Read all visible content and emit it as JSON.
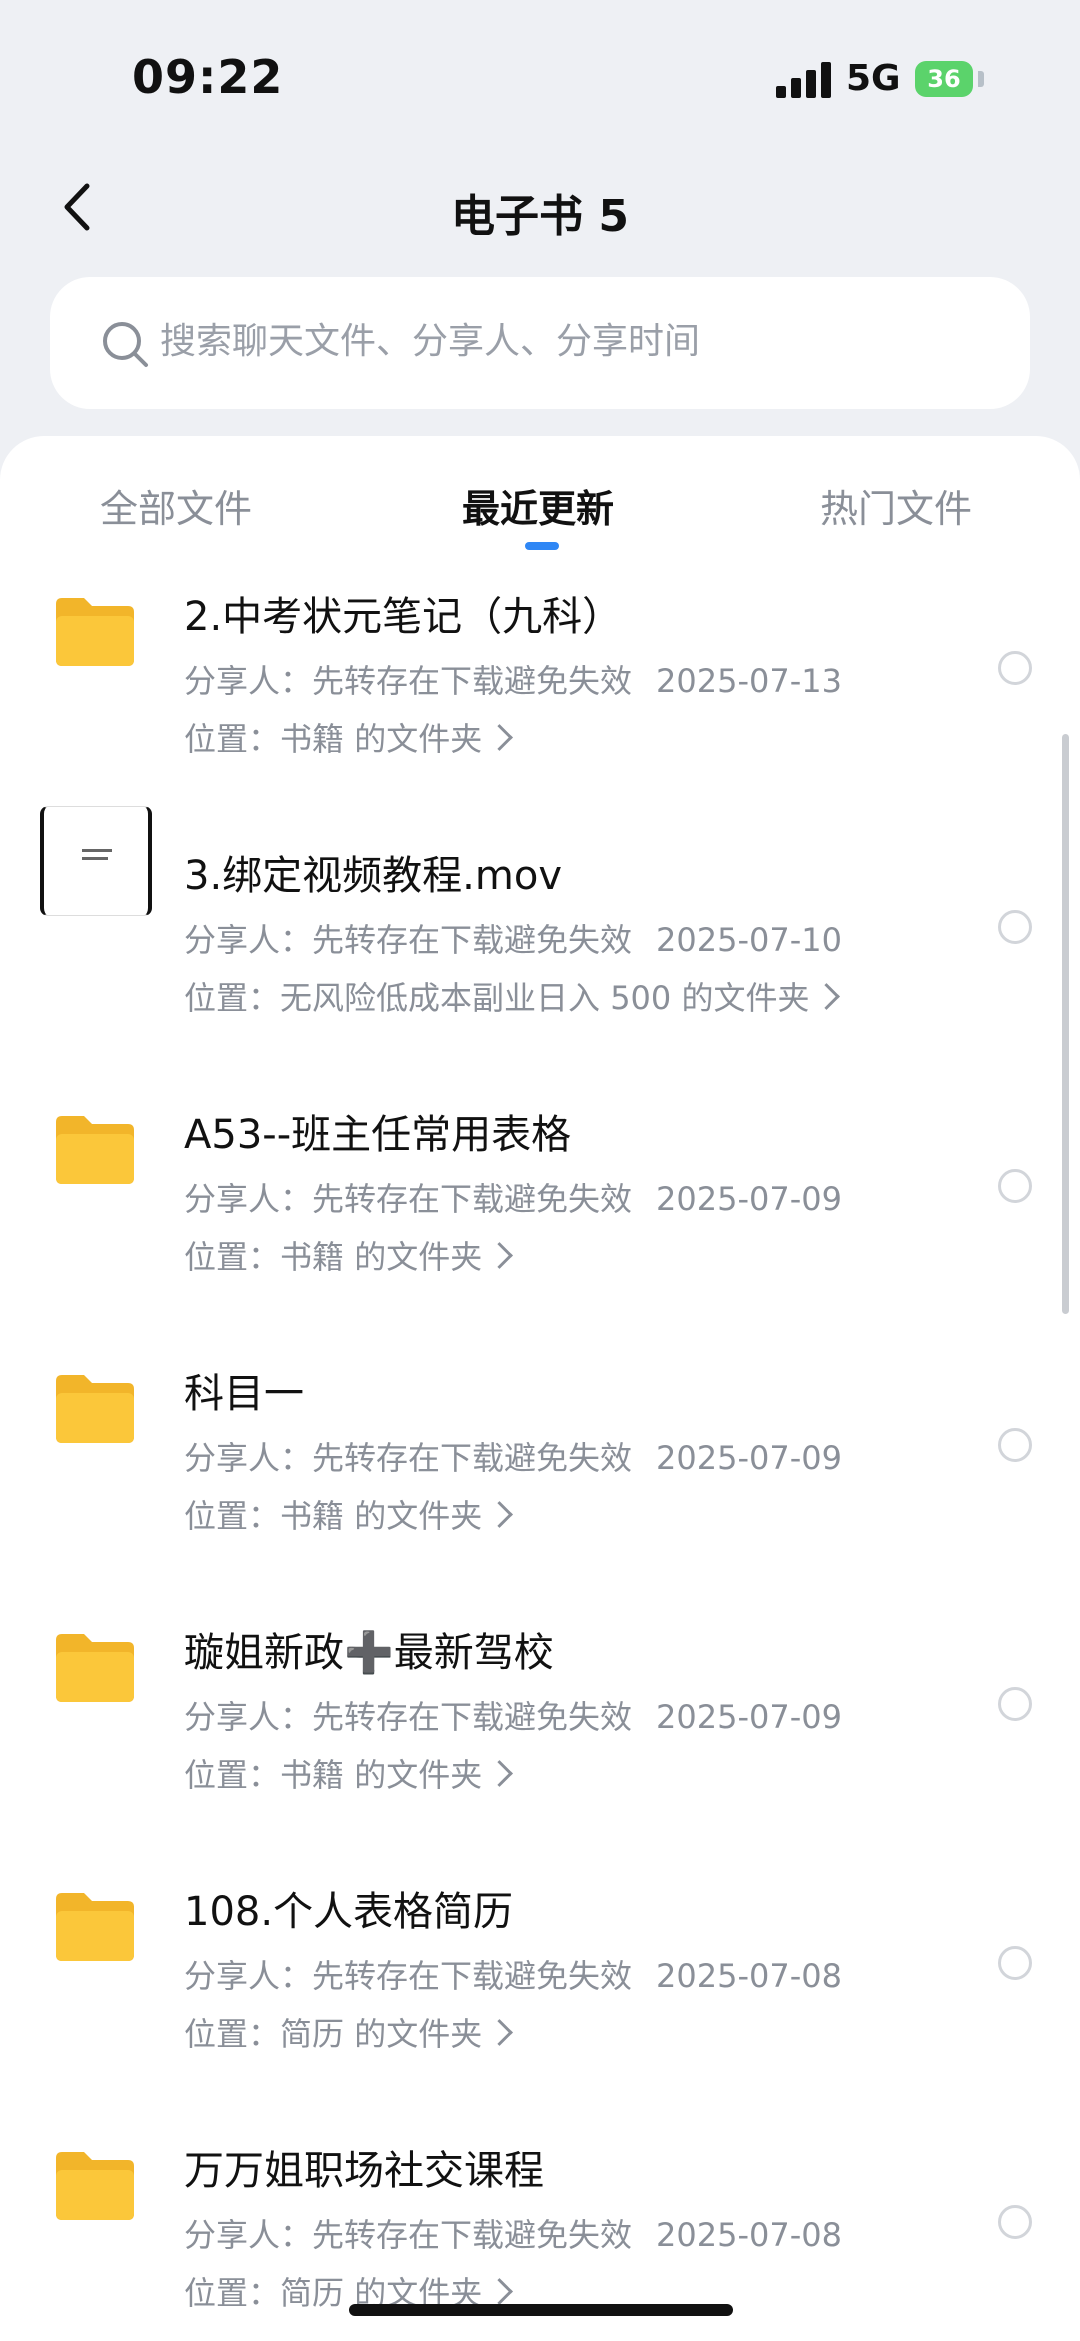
{
  "status_bar": {
    "time": "09:22",
    "network": "5G",
    "battery": "36"
  },
  "header": {
    "back_icon": "chevron-left-icon",
    "title": "电子书 5"
  },
  "search": {
    "placeholder": "搜索聊天文件、分享人、分享时间",
    "icon": "search-icon"
  },
  "tabs": [
    {
      "label": "全部文件",
      "active": false
    },
    {
      "label": "最近更新",
      "active": true
    },
    {
      "label": "热门文件",
      "active": false
    }
  ],
  "colors": {
    "accent": "#2f87f5",
    "folder": "#fbc73a",
    "battery": "#5bd36b"
  },
  "files": [
    {
      "type": "folder",
      "title": "2.中考状元笔记（九科）",
      "sharer_label": "分享人：",
      "sharer": "先转存在下载避免失效",
      "date": "2025-07-13",
      "location_label": "位置：",
      "location": "书籍",
      "location_suffix": "的文件夹"
    },
    {
      "type": "video",
      "title": "3.绑定视频教程.mov",
      "sharer_label": "分享人：",
      "sharer": "先转存在下载避免失效",
      "date": "2025-07-10",
      "location_label": "位置：",
      "location": "无风险低成本副业日入 500",
      "location_suffix": "的文件夹"
    },
    {
      "type": "folder",
      "title": "A53--班主任常用表格",
      "sharer_label": "分享人：",
      "sharer": "先转存在下载避免失效",
      "date": "2025-07-09",
      "location_label": "位置：",
      "location": "书籍",
      "location_suffix": "的文件夹"
    },
    {
      "type": "folder",
      "title": "科目一",
      "sharer_label": "分享人：",
      "sharer": "先转存在下载避免失效",
      "date": "2025-07-09",
      "location_label": "位置：",
      "location": "书籍",
      "location_suffix": "的文件夹"
    },
    {
      "type": "folder",
      "title": "璇姐新政➕最新驾校",
      "sharer_label": "分享人：",
      "sharer": "先转存在下载避免失效",
      "date": "2025-07-09",
      "location_label": "位置：",
      "location": "书籍",
      "location_suffix": "的文件夹"
    },
    {
      "type": "folder",
      "title": "108.个人表格简历",
      "sharer_label": "分享人：",
      "sharer": "先转存在下载避免失效",
      "date": "2025-07-08",
      "location_label": "位置：",
      "location": "简历",
      "location_suffix": "的文件夹"
    },
    {
      "type": "folder",
      "title": "万万姐职场社交课程",
      "sharer_label": "分享人：",
      "sharer": "先转存在下载避免失效",
      "date": "2025-07-08",
      "location_label": "位置：",
      "location": "简历",
      "location_suffix": "的文件夹"
    }
  ]
}
